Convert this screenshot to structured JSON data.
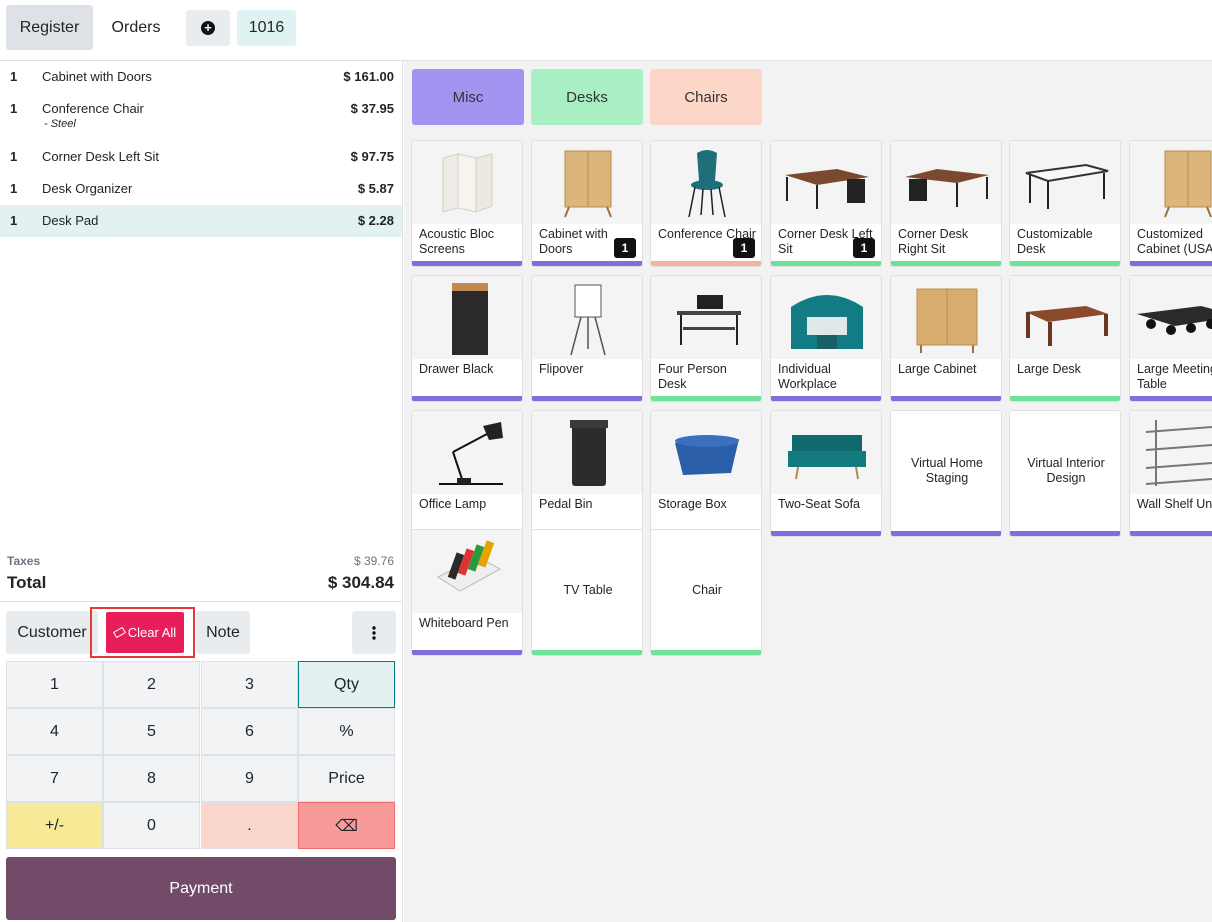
{
  "topbar": {
    "register_label": "Register",
    "orders_label": "Orders",
    "order_number": "1016"
  },
  "order_lines": [
    {
      "qty": "1",
      "name": "Cabinet with Doors",
      "price": "$ 161.00",
      "note": ""
    },
    {
      "qty": "1",
      "name": "Conference Chair",
      "price": "$ 37.95",
      "note": "- Steel"
    },
    {
      "qty": "1",
      "name": "Corner Desk Left Sit",
      "price": "$ 97.75",
      "note": ""
    },
    {
      "qty": "1",
      "name": "Desk Organizer",
      "price": "$ 5.87",
      "note": ""
    },
    {
      "qty": "1",
      "name": "Desk Pad",
      "price": "$ 2.28",
      "note": ""
    }
  ],
  "summary": {
    "taxes_label": "Taxes",
    "taxes_value": "$ 39.76",
    "total_label": "Total",
    "total_value": "$ 304.84"
  },
  "controls": {
    "customer_label": "Customer",
    "clear_all_label": "Clear All",
    "note_label": "Note"
  },
  "numpad": {
    "k1": "1",
    "k2": "2",
    "k3": "3",
    "qty": "Qty",
    "k4": "4",
    "k5": "5",
    "k6": "6",
    "pct": "%",
    "k7": "7",
    "k8": "8",
    "k9": "9",
    "price": "Price",
    "pm": "+/-",
    "k0": "0",
    "dot": ".",
    "bs": "⌫"
  },
  "payment_label": "Payment",
  "categories": [
    {
      "label": "Misc",
      "color": "#a295f1"
    },
    {
      "label": "Desks",
      "color": "#a8f0c3"
    },
    {
      "label": "Chairs",
      "color": "#fcd7c8"
    }
  ],
  "products": [
    {
      "name": "Acoustic Bloc Screens",
      "category": "misc",
      "badge": ""
    },
    {
      "name": "Cabinet with Doors",
      "category": "misc",
      "badge": "1"
    },
    {
      "name": "Conference Chair",
      "category": "chairs",
      "badge": "1"
    },
    {
      "name": "Corner Desk Left Sit",
      "category": "desks",
      "badge": "1"
    },
    {
      "name": "Corner Desk Right Sit",
      "category": "desks",
      "badge": ""
    },
    {
      "name": "Customizable Desk",
      "category": "desks",
      "badge": ""
    },
    {
      "name": "Customized Cabinet (USA)",
      "category": "misc",
      "badge": ""
    },
    {
      "name": "Drawer Black",
      "category": "misc",
      "badge": ""
    },
    {
      "name": "Flipover",
      "category": "misc",
      "badge": ""
    },
    {
      "name": "Four Person Desk",
      "category": "desks",
      "badge": ""
    },
    {
      "name": "Individual Workplace",
      "category": "misc",
      "badge": ""
    },
    {
      "name": "Large Cabinet",
      "category": "misc",
      "badge": ""
    },
    {
      "name": "Large Desk",
      "category": "desks",
      "badge": ""
    },
    {
      "name": "Large Meeting Table",
      "category": "misc",
      "badge": ""
    },
    {
      "name": "Office Lamp",
      "category": "misc",
      "badge": ""
    },
    {
      "name": "Pedal Bin",
      "category": "misc",
      "badge": ""
    },
    {
      "name": "Storage Box",
      "category": "misc",
      "badge": ""
    },
    {
      "name": "Two-Seat Sofa",
      "category": "misc",
      "badge": ""
    },
    {
      "name": "Virtual Home Staging",
      "category": "misc",
      "badge": ""
    },
    {
      "name": "Virtual Interior Design",
      "category": "misc",
      "badge": ""
    },
    {
      "name": "Wall Shelf Unit",
      "category": "misc",
      "badge": ""
    },
    {
      "name": "Whiteboard Pen",
      "category": "misc",
      "badge": ""
    },
    {
      "name": "TV Table",
      "category": "desks",
      "badge": ""
    },
    {
      "name": "Chair",
      "category": "desks",
      "badge": ""
    }
  ]
}
